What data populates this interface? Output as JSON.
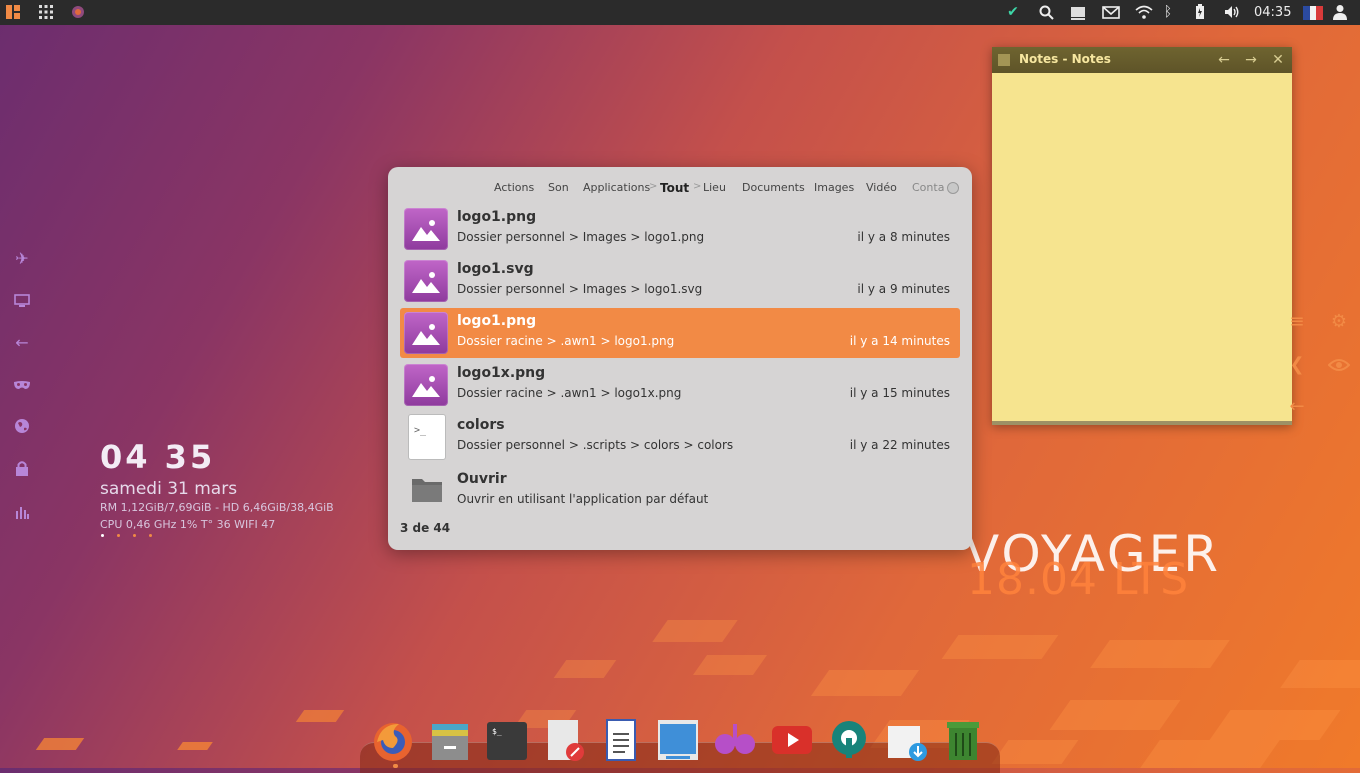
{
  "topbar": {
    "clock": "04:35"
  },
  "clock_widget": {
    "time": "04 35",
    "date": "samedi 31 mars",
    "line1": "RM 1,12GiB/7,69GiB  -  HD 6,46GiB/38,4GiB",
    "line2": "CPU 0,46 GHz 1%  T° 36   WIFI 47"
  },
  "launcher": {
    "tabs": [
      "Actions",
      "Son",
      "Applications",
      "Tout",
      "Lieu",
      "Documents",
      "Images",
      "Vidéo",
      "Conta"
    ],
    "active_tab": "Tout",
    "results": [
      {
        "title": "logo1.png",
        "path": "Dossier personnel > Images > logo1.png",
        "time": "il y a 8 minutes",
        "kind": "image"
      },
      {
        "title": "logo1.svg",
        "path": "Dossier personnel > Images > logo1.svg",
        "time": "il y a 9 minutes",
        "kind": "image"
      },
      {
        "title": "logo1.png",
        "path": "Dossier racine > .awn1 > logo1.png",
        "time": "il y a 14 minutes",
        "kind": "image",
        "selected": true
      },
      {
        "title": "logo1x.png",
        "path": "Dossier racine > .awn1 > logo1x.png",
        "time": "il y a 15 minutes",
        "kind": "image"
      },
      {
        "title": "colors",
        "path": "Dossier personnel > .scripts > colors > colors",
        "time": "il y a 22 minutes",
        "kind": "script"
      },
      {
        "title": "Ouvrir",
        "path": "Ouvrir en utilisant l'application par défaut",
        "time": "",
        "kind": "folder"
      }
    ],
    "count": "3 de 44"
  },
  "notes": {
    "title": "Notes - Notes"
  },
  "wallpaper": {
    "brand": "VOYAGER",
    "version": "18.04 LTS"
  },
  "colors": {
    "accent": "#f28a45",
    "sidebar_icon": "#b786d8"
  }
}
